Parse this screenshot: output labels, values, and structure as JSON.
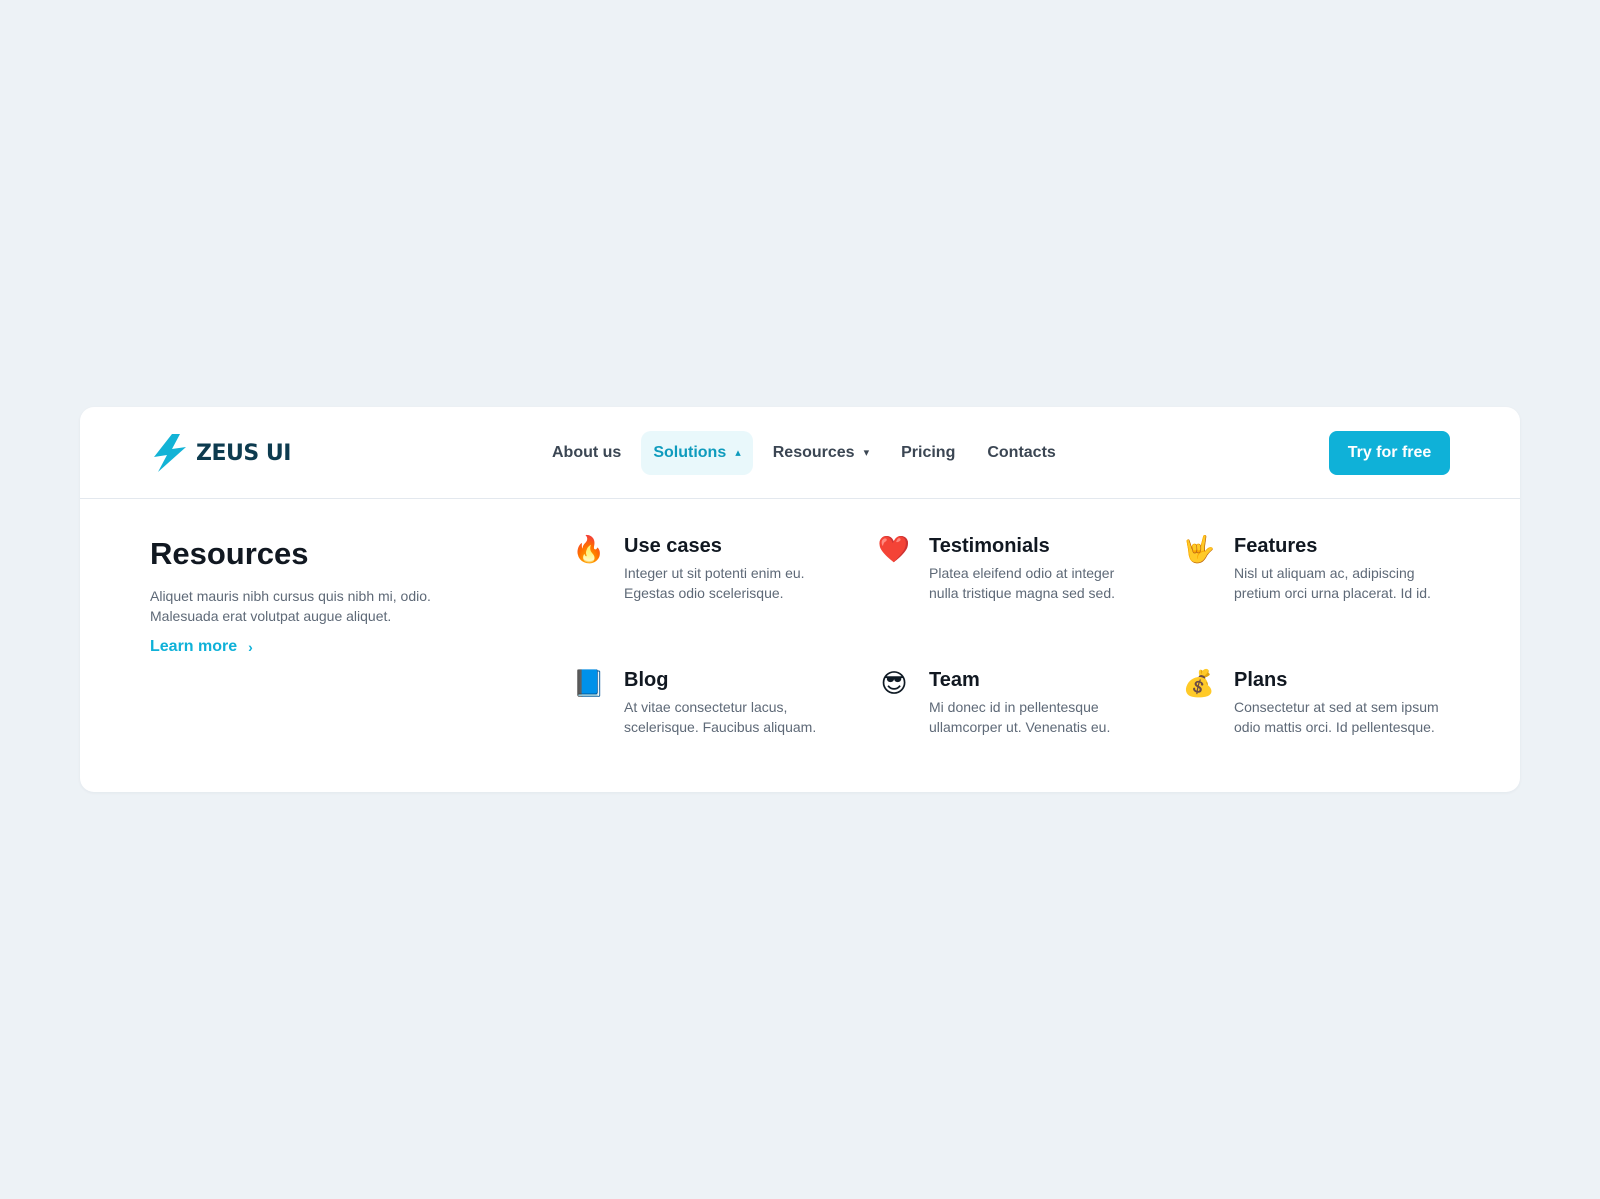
{
  "brand": {
    "name": "ZEUS UI",
    "accent": "#0fb1d8",
    "dark": "#0d3b4f"
  },
  "nav": {
    "items": [
      {
        "label": "About us"
      },
      {
        "label": "Solutions",
        "chevron": "▴",
        "active": true
      },
      {
        "label": "Resources",
        "chevron": "▾"
      },
      {
        "label": "Pricing"
      },
      {
        "label": "Contacts"
      }
    ],
    "cta_label": "Try for free"
  },
  "intro": {
    "title": "Resources",
    "description": "Aliquet mauris nibh cursus quis nibh mi, odio. Malesuada erat volutpat augue aliquet.",
    "link_label": "Learn more",
    "link_arrow": "›"
  },
  "tiles": [
    {
      "icon": "fire-emoji-icon",
      "glyph": "🔥",
      "title": "Use cases",
      "description": "Integer ut sit potenti enim eu. Egestas odio scelerisque."
    },
    {
      "icon": "heart-emoji-icon",
      "glyph": "❤️",
      "title": "Testimonials",
      "description": "Platea eleifend odio at integer nulla tristique magna sed sed."
    },
    {
      "icon": "rock-hand-emoji-icon",
      "glyph": "🤟",
      "title": "Features",
      "description": "Nisl ut aliquam ac, adipiscing pretium orci urna placerat. Id id."
    },
    {
      "icon": "book-emoji-icon",
      "glyph": "📘",
      "title": "Blog",
      "description": "At vitae consectetur lacus, scelerisque. Faucibus aliquam."
    },
    {
      "icon": "sunglasses-emoji-icon",
      "glyph": "😎",
      "title": "Team",
      "description": "Mi donec id in pellentesque ullamcorper ut. Venenatis eu."
    },
    {
      "icon": "money-bag-emoji-icon",
      "glyph": "💰",
      "title": "Plans",
      "description": "Consectetur at sed at sem ipsum odio mattis orci. Id pellentesque."
    }
  ]
}
